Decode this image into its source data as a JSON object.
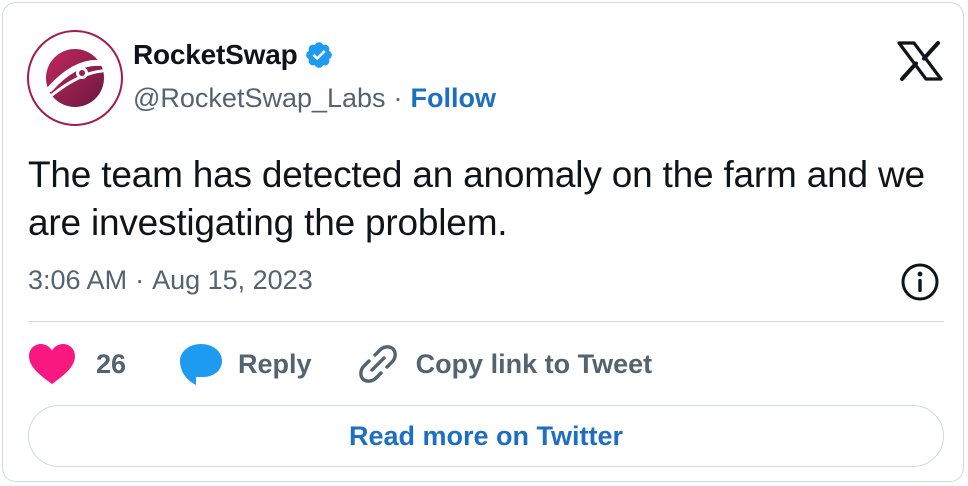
{
  "account": {
    "name": "RocketSwap",
    "handle": "@RocketSwap_Labs",
    "separator": "·",
    "follow_label": "Follow",
    "verified": true,
    "brand_color": "#a11d4f"
  },
  "tweet": {
    "text": "The team has detected an anomaly on the farm and we are investigating the problem.",
    "time": "3:06 AM",
    "date": "Aug 15, 2023",
    "separator": "·"
  },
  "actions": {
    "like_count": "26",
    "reply_label": "Reply",
    "copy_label": "Copy link to Tweet"
  },
  "footer": {
    "read_more_label": "Read more on Twitter"
  },
  "icons": {
    "like": "heart-icon",
    "reply": "speech-bubble-icon",
    "copy": "link-icon",
    "info": "info-icon",
    "platform": "x-logo-icon",
    "verified": "verified-badge-icon"
  },
  "colors": {
    "link": "#1d6fc4",
    "heart": "#f91880",
    "reply_bubble": "#1d9bf0",
    "muted_text": "#536471"
  }
}
